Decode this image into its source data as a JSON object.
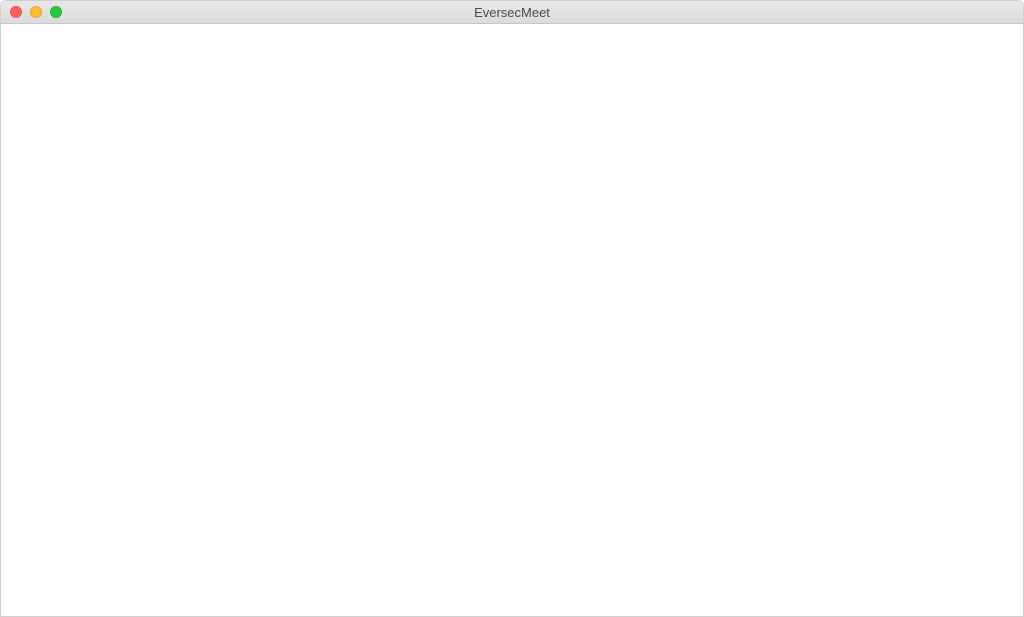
{
  "window": {
    "title": "EversecMeet"
  }
}
